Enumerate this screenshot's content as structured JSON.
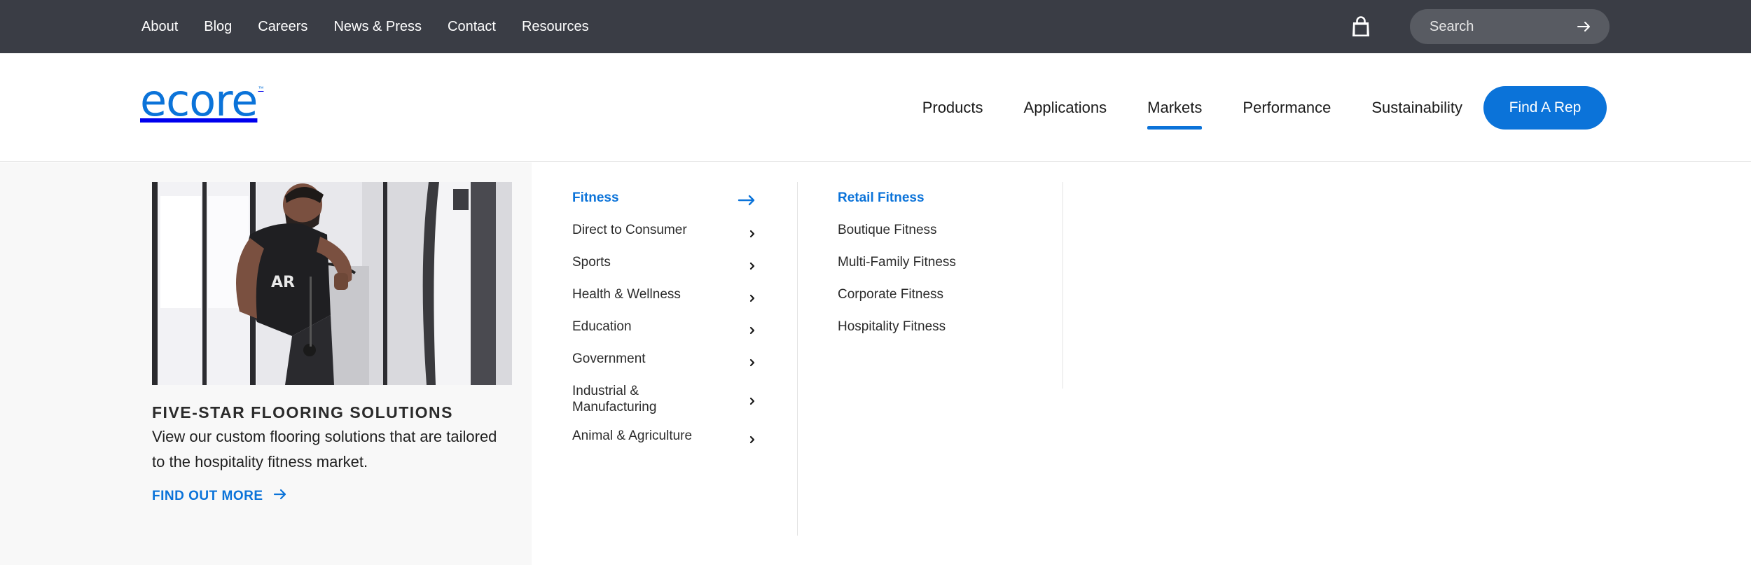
{
  "topbar": {
    "links": [
      "About",
      "Blog",
      "Careers",
      "News & Press",
      "Contact",
      "Resources"
    ],
    "search_placeholder": "Search",
    "cart_icon": "shopping-bag-icon"
  },
  "header": {
    "logo_text": "ecore",
    "logo_tm": "™",
    "nav": [
      "Products",
      "Applications",
      "Markets",
      "Performance",
      "Sustainability"
    ],
    "active_nav": "Markets",
    "cta_label": "Find A Rep"
  },
  "mega_menu": {
    "promo": {
      "image_subject": "man using cable machine in gym",
      "title": "FIVE-STAR FLOORING SOLUTIONS",
      "text": "View our custom flooring solutions that are tailored to the hospitality fitness market.",
      "link_label": "FIND OUT MORE"
    },
    "markets": [
      "Fitness",
      "Direct to Consumer",
      "Sports",
      "Health & Wellness",
      "Education",
      "Government",
      "Industrial & Manufacturing",
      "Animal & Agriculture"
    ],
    "active_market": "Fitness",
    "submarkets": [
      "Retail Fitness",
      "Boutique Fitness",
      "Multi-Family Fitness",
      "Corporate Fitness",
      "Hospitality Fitness"
    ],
    "active_submarket": "Retail Fitness"
  },
  "colors": {
    "brand_blue": "#0b73d9",
    "topbar_bg": "#3a3d45",
    "search_bg": "#585b62",
    "promo_bg": "#f8f8f8"
  }
}
